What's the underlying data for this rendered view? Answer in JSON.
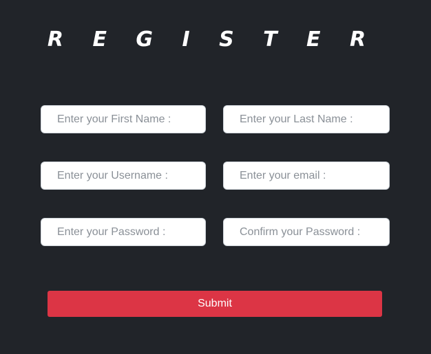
{
  "form": {
    "title": "R E G I S T E R",
    "fields": {
      "first_name": {
        "placeholder": "Enter your First Name :",
        "value": ""
      },
      "last_name": {
        "placeholder": "Enter your Last Name :",
        "value": ""
      },
      "username": {
        "placeholder": "Enter your Username :",
        "value": ""
      },
      "email": {
        "placeholder": "Enter your email :",
        "value": ""
      },
      "password": {
        "placeholder": "Enter your Password :",
        "value": ""
      },
      "confirm_password": {
        "placeholder": "Confirm your Password :",
        "value": ""
      }
    },
    "submit_label": "Submit"
  },
  "colors": {
    "background": "#212429",
    "field_background": "#ffffff",
    "placeholder": "#8a9097",
    "submit_background": "#dc3545",
    "title_text": "#ffffff"
  }
}
